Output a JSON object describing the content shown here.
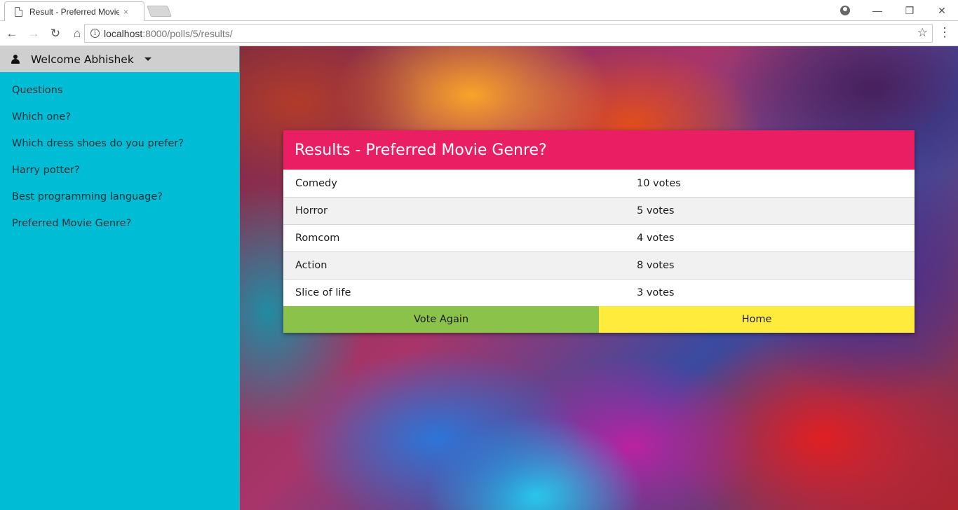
{
  "browser": {
    "tab_title": "Result - Preferred Movie Genre?",
    "tab_close": "×",
    "url_host": "localhost",
    "url_rest": ":8000/polls/5/results/"
  },
  "user": {
    "welcome": "Welcome Abhishek"
  },
  "sidebar": {
    "items": [
      {
        "label": "Questions"
      },
      {
        "label": "Which one?"
      },
      {
        "label": "Which dress shoes do you prefer?"
      },
      {
        "label": "Harry potter?"
      },
      {
        "label": "Best programming language?"
      },
      {
        "label": "Preferred Movie Genre?"
      }
    ]
  },
  "results": {
    "title": "Results - Preferred Movie Genre?",
    "rows": [
      {
        "choice": "Comedy",
        "votes": "10 votes"
      },
      {
        "choice": "Horror",
        "votes": "5 votes"
      },
      {
        "choice": "Romcom",
        "votes": "4 votes"
      },
      {
        "choice": "Action",
        "votes": "8 votes"
      },
      {
        "choice": "Slice of life",
        "votes": "3 votes"
      }
    ],
    "vote_again_label": "Vote Again",
    "home_label": "Home"
  },
  "colors": {
    "sidebar": "#00bcd4",
    "header": "#e91e63",
    "vote_button": "#8bc34a",
    "home_button": "#ffeb3b"
  }
}
